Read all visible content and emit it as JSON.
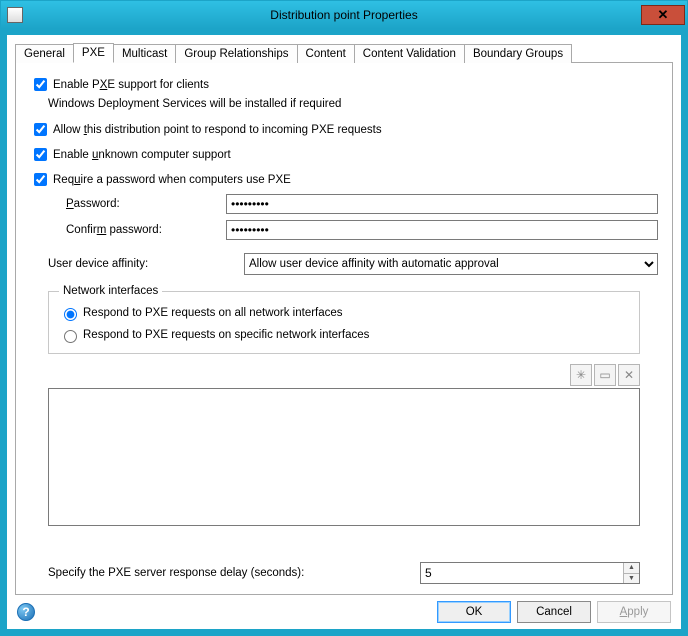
{
  "window": {
    "title": "Distribution point Properties"
  },
  "tabs": {
    "general": "General",
    "pxe": "PXE",
    "multicast": "Multicast",
    "group_relationships": "Group Relationships",
    "content": "Content",
    "content_validation": "Content Validation",
    "boundary_groups": "Boundary Groups",
    "active": "pxe"
  },
  "pxe": {
    "enable_label_pre": "Enable P",
    "enable_label_u": "X",
    "enable_label_post": "E support for clients",
    "wds_note": "Windows Deployment Services will be installed if required",
    "allow_respond_pre": "Allow ",
    "allow_respond_u": "t",
    "allow_respond_post": "his distribution point to respond to incoming PXE requests",
    "unknown_pre": "Enable ",
    "unknown_u": "u",
    "unknown_post": "nknown computer support",
    "require_pw_pre": "Req",
    "require_pw_u": "u",
    "require_pw_post": "ire a password when computers use PXE",
    "password_label_u": "P",
    "password_label_post": "assword:",
    "confirm_label_pre": "Confir",
    "confirm_label_u": "m",
    "confirm_label_post": " password:",
    "password_value": "•••••••••",
    "confirm_value": "•••••••••",
    "uda_label": "User device affinity:",
    "uda_selected": "Allow user device affinity with automatic approval",
    "net_legend": "Network interfaces",
    "net_all": "Respond to PXE requests on all network interfaces",
    "net_specific": "Respond to PXE requests on specific network interfaces",
    "net_selected": "all",
    "delay_label": "Specify the PXE server response delay (seconds):",
    "delay_value": "5"
  },
  "toolbar_icons": {
    "new": "✳",
    "edit": "▭",
    "delete": "✕"
  },
  "buttons": {
    "ok": "OK",
    "cancel": "Cancel",
    "apply_u": "A",
    "apply_post": "pply"
  }
}
